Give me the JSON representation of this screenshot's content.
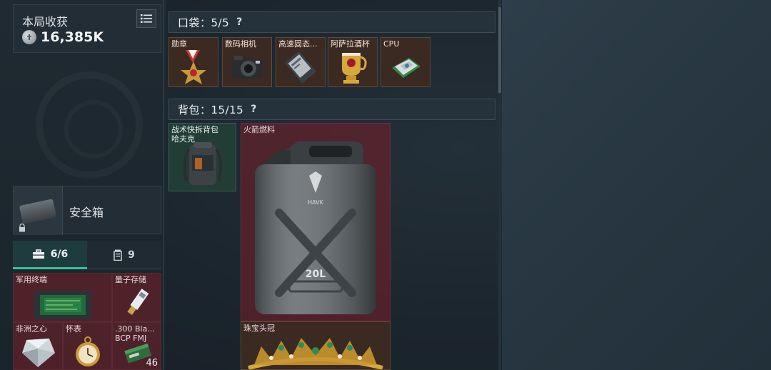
{
  "loot": {
    "title": "本局收获",
    "value": "16,385K"
  },
  "safe_box": {
    "label": "安全箱"
  },
  "tabs": [
    {
      "label": "6/6",
      "icon": "toolbox-icon",
      "active": true
    },
    {
      "label": "9",
      "icon": "canister-icon",
      "active": false
    }
  ],
  "safe_items": [
    {
      "label": "军用终端"
    },
    {
      "label": "量子存储"
    },
    {
      "label": "非洲之心"
    },
    {
      "label": "怀表"
    },
    {
      "label": ".300 Bla... BCP FMJ",
      "count": "46"
    }
  ],
  "pockets": {
    "title": "口袋：5/5",
    "help": "?",
    "items": [
      {
        "label": "勋章"
      },
      {
        "label": "数码相机"
      },
      {
        "label": "高速固态..."
      },
      {
        "label": "阿萨拉酒杯"
      },
      {
        "label": "CPU"
      }
    ]
  },
  "backpack": {
    "title": "背包：15/15",
    "help": "?",
    "items": [
      {
        "label": "战术快拆背包 哈夫克"
      },
      {
        "label": "火箭燃料",
        "can_brand": "HAVK",
        "can_volume": "20L"
      },
      {
        "label": "珠宝头冠"
      }
    ]
  },
  "colors": {
    "rare_red": "#70202a",
    "gold_tier": "#3a2a22",
    "green_tier": "#223d36",
    "accent_teal": "#3fbf9a"
  }
}
